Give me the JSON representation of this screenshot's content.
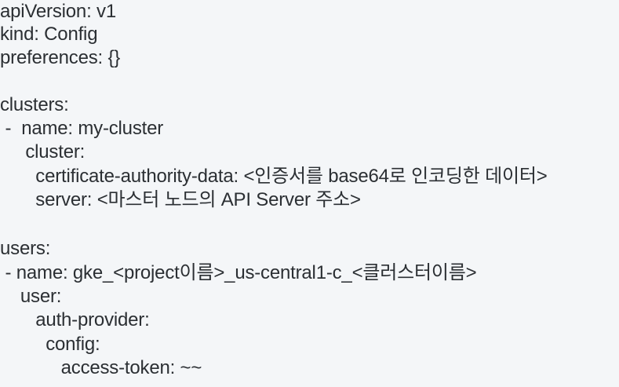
{
  "lines": [
    "apiVersion: v1",
    "kind: Config",
    "preferences: {}",
    "",
    "clusters:",
    " -  name: my-cluster",
    "     cluster:",
    "       certificate-authority-data: <인증서를 base64로 인코딩한 데이터>",
    "       server: <마스터 노드의 API Server 주소>",
    "",
    "users:",
    " - name: gke_<project이름>_us-central1-c_<클러스터이름>",
    "    user:",
    "       auth-provider:",
    "         config:",
    "            access-token: ~~"
  ]
}
